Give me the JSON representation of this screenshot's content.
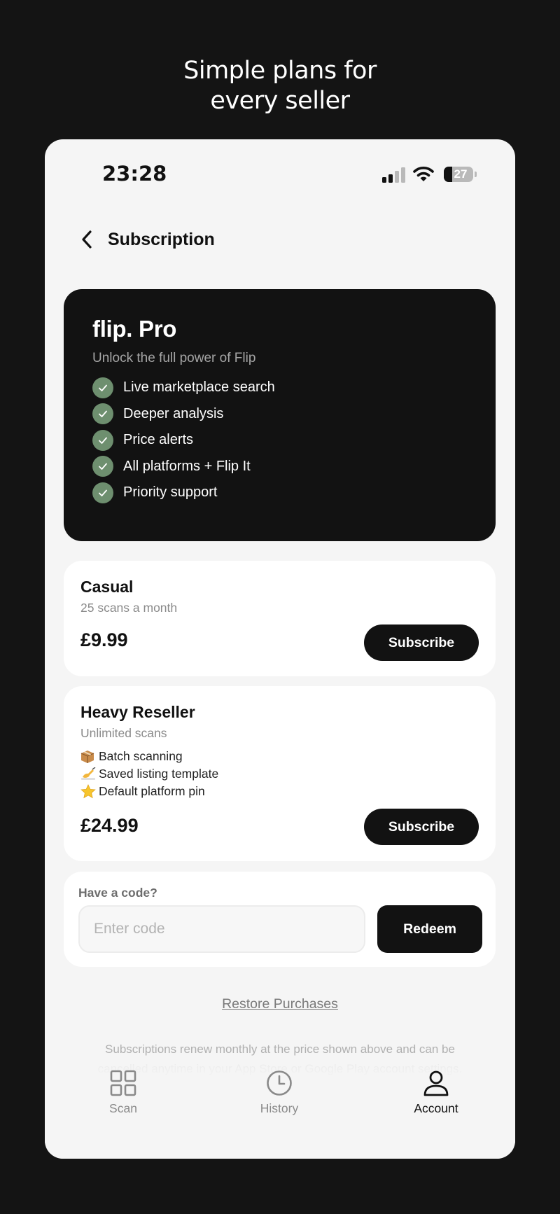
{
  "headline": {
    "line1": "Simple plans for",
    "line2": "every seller"
  },
  "status_bar": {
    "time": "23:28",
    "battery": "27",
    "icons": [
      "signal-icon",
      "wifi-icon",
      "battery-icon"
    ]
  },
  "header": {
    "title": "Subscription",
    "back_icon": "chevron-left-icon"
  },
  "pro": {
    "title": "flip. Pro",
    "subtitle": "Unlock the full power of Flip",
    "features": [
      "Live marketplace search",
      "Deeper analysis",
      "Price alerts",
      "All platforms + Flip It",
      "Priority support"
    ]
  },
  "plans": [
    {
      "name": "Casual",
      "description": "25 scans a month",
      "price": "£9.99",
      "button": "Subscribe"
    },
    {
      "name": "Heavy Reseller",
      "description": "Unlimited scans",
      "perks": [
        {
          "icon": "package-icon",
          "label": "Batch scanning"
        },
        {
          "icon": "writing-hand-icon",
          "label": "Saved listing template"
        },
        {
          "icon": "star-icon",
          "label": "Default platform pin"
        }
      ],
      "price": "£24.99",
      "button": "Subscribe"
    }
  ],
  "code": {
    "label": "Have a code?",
    "placeholder": "Enter code",
    "value": "",
    "button": "Redeem"
  },
  "restore": "Restore Purchases",
  "legal": "Subscriptions renew monthly at the price shown above and can be cancelled anytime in your App Store or Google Play account settings. Payment will be charged to your account at confirmation of purchase.",
  "tabs": [
    {
      "label": "Scan",
      "icon": "grid-icon",
      "active": false
    },
    {
      "label": "History",
      "icon": "clock-icon",
      "active": false
    },
    {
      "label": "Account",
      "icon": "user-icon",
      "active": true
    }
  ],
  "colors": {
    "background": "#141414",
    "card_dark": "#121212",
    "check_green": "#6e8f6f",
    "screen": "#f5f5f5"
  }
}
